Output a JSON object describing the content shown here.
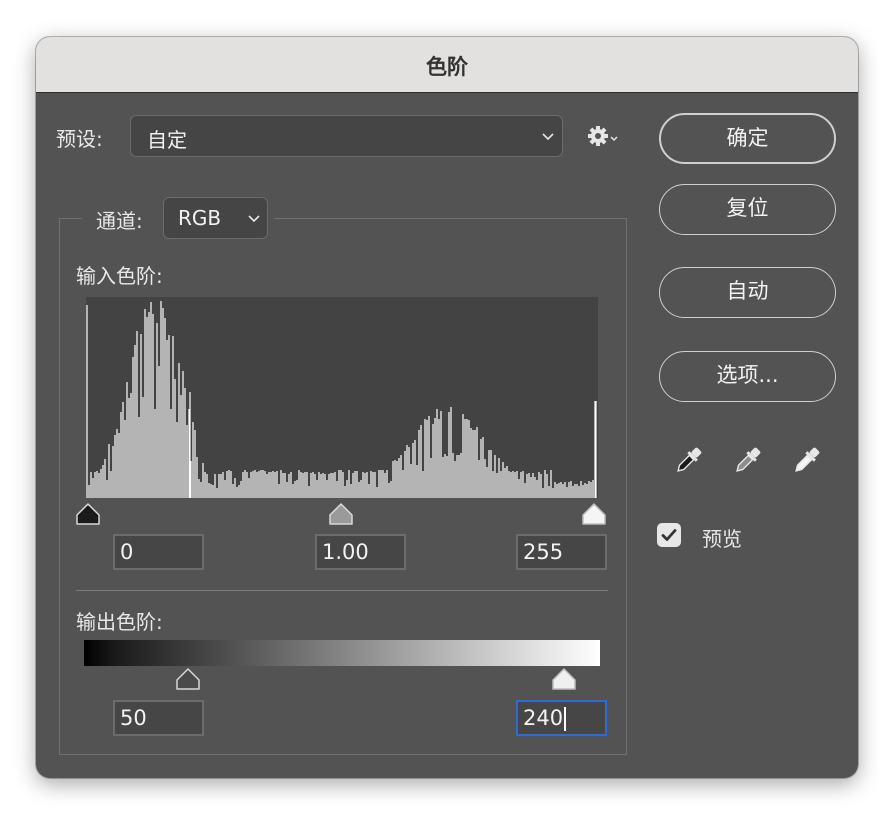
{
  "dialog": {
    "title": "色阶"
  },
  "preset": {
    "label": "预设:",
    "value": "自定"
  },
  "channel": {
    "label": "通道:",
    "value": "RGB"
  },
  "input_levels": {
    "label": "输入色阶:",
    "black": "0",
    "gamma": "1.00",
    "white": "255"
  },
  "output_levels": {
    "label": "输出色阶:",
    "black": "50",
    "white": "240"
  },
  "buttons": {
    "ok": "确定",
    "reset": "复位",
    "auto": "自动",
    "options": "选项..."
  },
  "preview": {
    "label": "预览",
    "checked": true
  },
  "icons": {
    "settings": "gear-icon",
    "black_point": "black-eyedropper-icon",
    "gray_point": "gray-eyedropper-icon",
    "white_point": "white-eyedropper-icon"
  },
  "colors": {
    "panel": "#535353",
    "titlebar": "#e2e1df",
    "focus": "#2e6bd6"
  }
}
